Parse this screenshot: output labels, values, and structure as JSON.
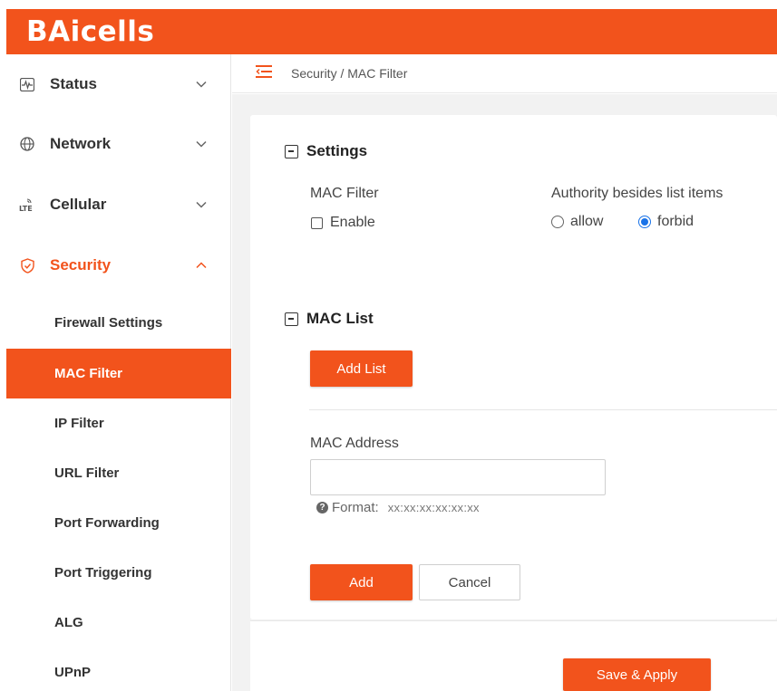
{
  "header": {
    "logo_text": "BAicells",
    "background_color": "#f2531c"
  },
  "sidebar": {
    "menus": [
      {
        "label": "Status",
        "icon": "pulse-icon",
        "expanded": false
      },
      {
        "label": "Network",
        "icon": "globe-icon",
        "expanded": false
      },
      {
        "label": "Cellular",
        "icon": "lte-icon",
        "expanded": false
      },
      {
        "label": "Security",
        "icon": "shield-icon",
        "expanded": true
      }
    ],
    "security_items": [
      {
        "label": "Firewall Settings",
        "selected": false
      },
      {
        "label": "MAC Filter",
        "selected": true
      },
      {
        "label": "IP Filter",
        "selected": false
      },
      {
        "label": "URL Filter",
        "selected": false
      },
      {
        "label": "Port Forwarding",
        "selected": false
      },
      {
        "label": "Port Triggering",
        "selected": false
      },
      {
        "label": "ALG",
        "selected": false
      },
      {
        "label": "UPnP",
        "selected": false
      }
    ]
  },
  "topbar": {
    "breadcrumb": "Security / MAC Filter"
  },
  "settings": {
    "title": "Settings",
    "mac_filter_label": "MAC Filter",
    "enable_label": "Enable",
    "enable_checked": false,
    "authority_label": "Authority besides list items",
    "options": [
      {
        "label": "allow",
        "selected": false
      },
      {
        "label": "forbid",
        "selected": true
      }
    ]
  },
  "mac_list": {
    "title": "MAC List",
    "add_list_label": "Add List",
    "mac_address_label": "MAC Address",
    "mac_address_value": "",
    "format_label": "Format:",
    "format_value": "xx:xx:xx:xx:xx:xx",
    "add_label": "Add",
    "cancel_label": "Cancel"
  },
  "footer": {
    "save_apply_label": "Save & Apply"
  },
  "colors": {
    "accent": "#f2531c",
    "radio_selected": "#1a73e8"
  }
}
